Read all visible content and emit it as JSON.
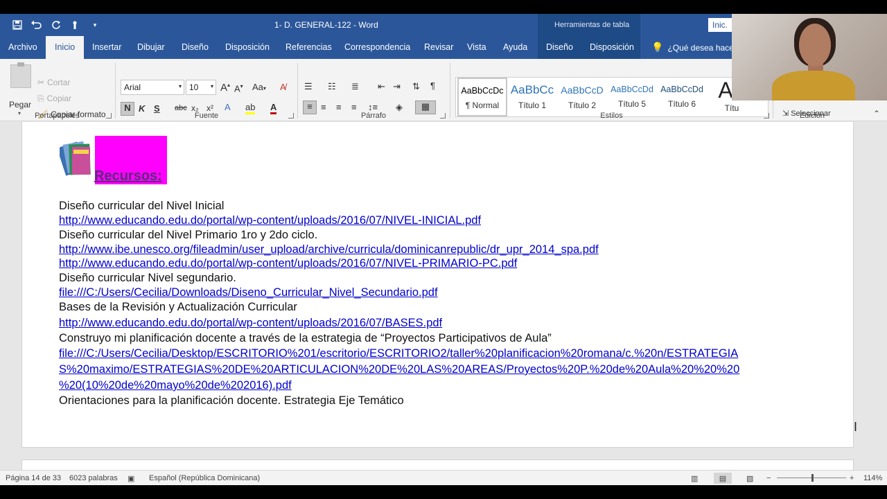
{
  "window": {
    "title": "1- D. GENERAL-122  -  Word",
    "context_tools_label": "Herramientas de tabla",
    "account_button": "Inic."
  },
  "tabs": [
    {
      "label": "Archivo"
    },
    {
      "label": "Inicio"
    },
    {
      "label": "Insertar"
    },
    {
      "label": "Dibujar"
    },
    {
      "label": "Diseño"
    },
    {
      "label": "Disposición"
    },
    {
      "label": "Referencias"
    },
    {
      "label": "Correspondencia"
    },
    {
      "label": "Revisar"
    },
    {
      "label": "Vista"
    },
    {
      "label": "Ayuda"
    },
    {
      "label": "Diseño"
    },
    {
      "label": "Disposición"
    }
  ],
  "tell_me": "¿Qué desea hacer",
  "ribbon": {
    "clipboard": {
      "label": "Portapapeles",
      "paste": "Pegar",
      "cut": "Cortar",
      "copy": "Copiar",
      "format_painter": "Copiar formato"
    },
    "font": {
      "label": "Fuente",
      "font_name": "Arial",
      "font_size": "10",
      "bold": "N",
      "italic": "K",
      "underline": "S",
      "strike": "abc",
      "subscript": "x₂",
      "superscript": "x²",
      "font_color": "A",
      "case": "Aa"
    },
    "paragraph": {
      "label": "Párrafo"
    },
    "styles": {
      "label": "Estilos",
      "items": [
        {
          "sample": "AaBbCcDc",
          "name": "¶ Normal"
        },
        {
          "sample": "AaBbCc",
          "name": "Título 1"
        },
        {
          "sample": "AaBbCcD",
          "name": "Título 2"
        },
        {
          "sample": "AaBbCcDd",
          "name": "Título 5"
        },
        {
          "sample": "AaBbCcDd",
          "name": "Título 6"
        },
        {
          "sample": "Aa",
          "name": "Títu"
        }
      ]
    },
    "editing": {
      "label": "Edición",
      "select": "Seleccionar"
    }
  },
  "document": {
    "heading": "Recursos:",
    "lines": [
      {
        "text": "Diseño curricular del Nivel Inicial",
        "link": false
      },
      {
        "text": "http://www.educando.edu.do/portal/wp-content/uploads/2016/07/NIVEL-INICIAL.pdf",
        "link": true
      },
      {
        "text": "Diseño curricular del Nivel Primario 1ro y 2do ciclo.",
        "link": false
      },
      {
        "text": "http://www.ibe.unesco.org/fileadmin/user_upload/archive/curricula/dominicanrepublic/dr_upr_2014_spa.pdf",
        "link": true
      },
      {
        "text": "http://www.educando.edu.do/portal/wp-content/uploads/2016/07/NIVEL-PRIMARIO-PC.pdf",
        "link": true
      },
      {
        "text": "Diseño curricular Nivel segundario.",
        "link": false
      },
      {
        "text": " file:///C:/Users/Cecilia/Downloads/Diseno_Curricular_Nivel_Secundario.pdf",
        "link": true
      },
      {
        "text": "Bases de la Revisión y Actualización Curricular",
        "link": false
      },
      {
        "text": "http://www.educando.edu.do/portal/wp-content/uploads/2016/07/BASES.pdf",
        "link": true
      },
      {
        "text": "Construyo mi planificación docente a través de la estrategia de “Proyectos Participativos de Aula”",
        "link": false
      },
      {
        "text": "file:///C:/Users/Cecilia/Desktop/ESCRITORIO%201/escritorio/ESCRITORIO2/taller%20planificacion%20romana/c.%20n/ESTRATEGIA",
        "link": true
      },
      {
        "text": "S%20maximo/ESTRATEGIAS%20DE%20ARTICULACION%20DE%20LAS%20AREAS/Proyectos%20P.%20de%20Aula%20%20%20",
        "link": true
      },
      {
        "text": "%20(10%20de%20mayo%20de%202016).pdf",
        "link": true
      },
      {
        "text": "Orientaciones para la planificación docente. Estrategia Eje Temático",
        "link": false
      }
    ]
  },
  "status": {
    "page": "Página 14 de 33",
    "words": "6023 palabras",
    "language": "Español (República Dominicana)",
    "zoom": "114%"
  },
  "colors": {
    "accent": "#2b579a",
    "link": "#0000cc",
    "highlight_box": "#ff00ff"
  }
}
